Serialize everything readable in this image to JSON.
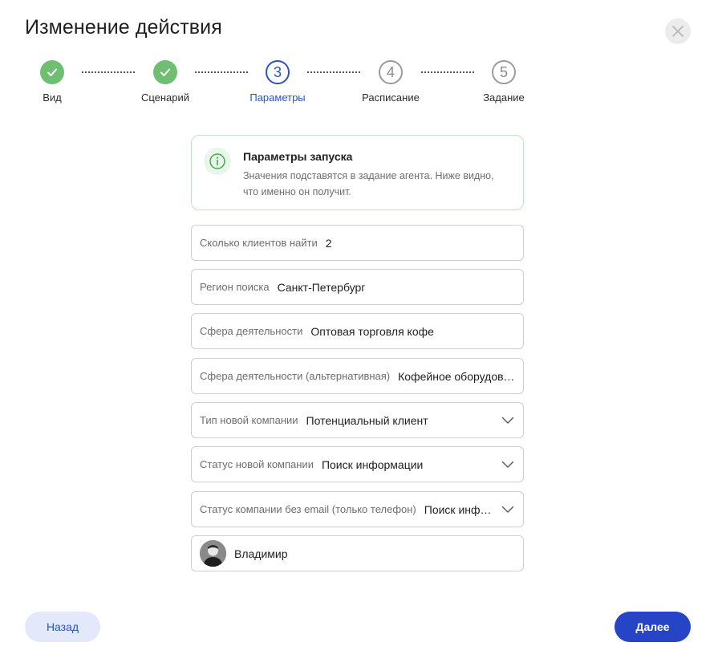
{
  "dialog": {
    "title": "Изменение действия"
  },
  "stepper": {
    "steps": [
      {
        "number": "1",
        "label": "Вид",
        "state": "done"
      },
      {
        "number": "2",
        "label": "Сценарий",
        "state": "done"
      },
      {
        "number": "3",
        "label": "Параметры",
        "state": "current"
      },
      {
        "number": "4",
        "label": "Расписание",
        "state": "todo"
      },
      {
        "number": "5",
        "label": "Задание",
        "state": "todo"
      }
    ]
  },
  "info": {
    "title": "Параметры запуска",
    "text": "Значения подставятся в задание агента. Ниже видно, что именно он получит."
  },
  "fields": [
    {
      "label": "Сколько клиентов найти",
      "value": "2",
      "type": "text"
    },
    {
      "label": "Регион поиска",
      "value": "Санкт-Петербург",
      "type": "text"
    },
    {
      "label": "Сфера деятельности",
      "value": "Оптовая торговля кофе",
      "type": "text"
    },
    {
      "label": "Сфера деятельности (альтернативная)",
      "value": "Кофейное оборудование",
      "type": "text"
    },
    {
      "label": "Тип новой компании",
      "value": "Потенциальный клиент",
      "type": "select"
    },
    {
      "label": "Статус новой компании",
      "value": "Поиск информации",
      "type": "select"
    },
    {
      "label": "Статус компании без email (только телефон)",
      "value": "Поиск информации",
      "type": "select"
    }
  ],
  "user": {
    "name": "Владимир"
  },
  "buttons": {
    "back_label": "Назад",
    "next_label": "Далее"
  },
  "colors": {
    "primary": "#2645c6",
    "done": "#6fbf73",
    "info_border": "#bfe5c3"
  }
}
